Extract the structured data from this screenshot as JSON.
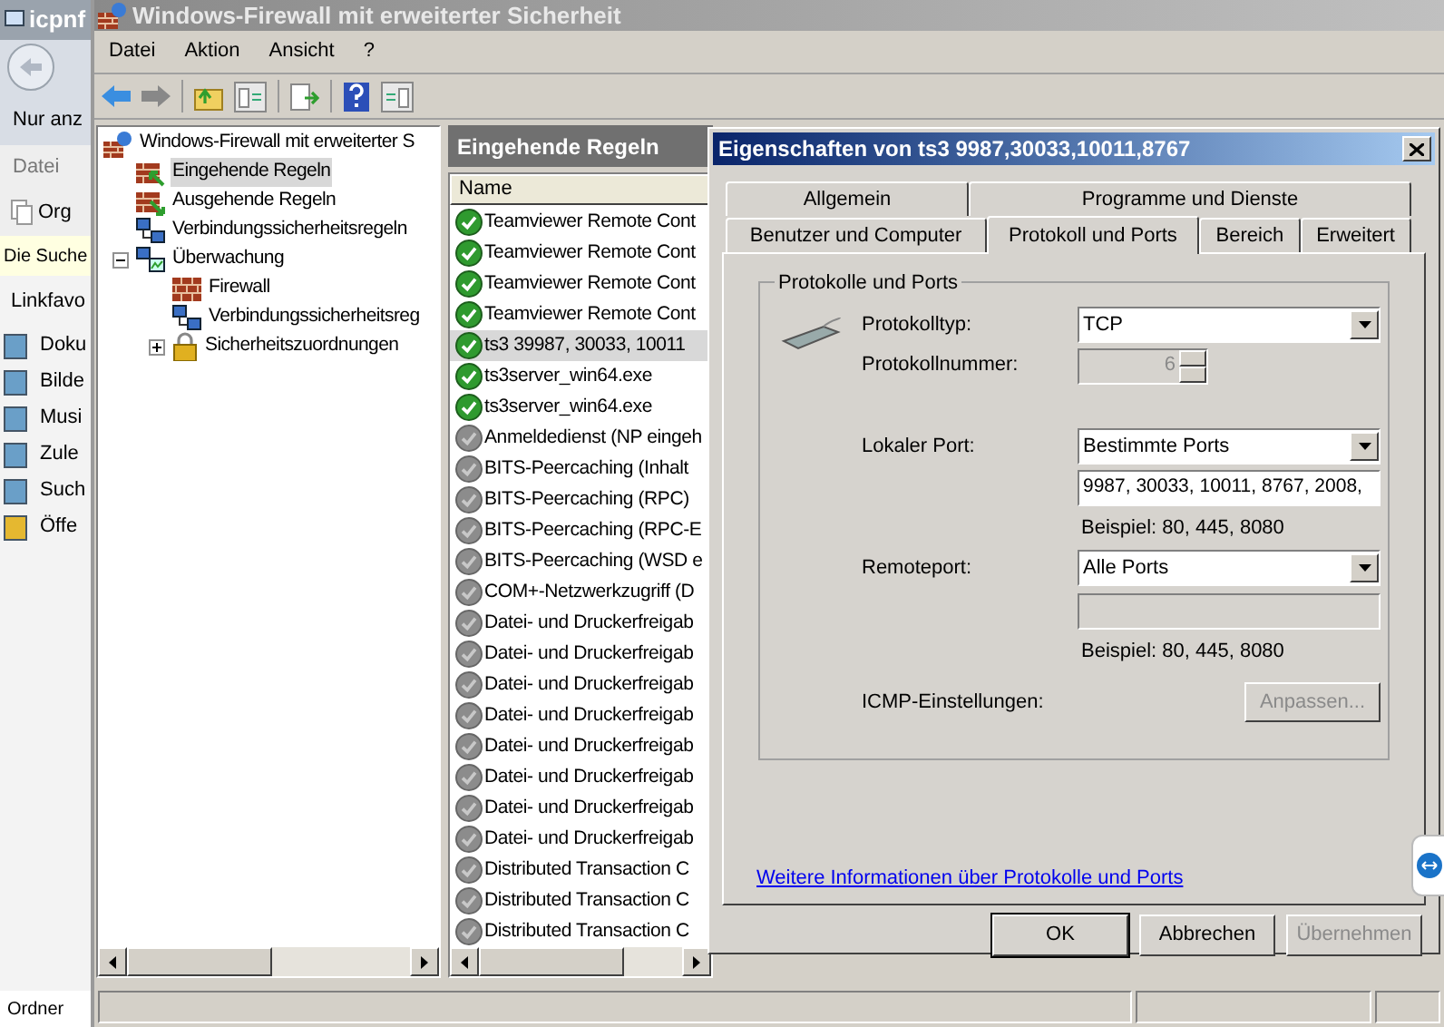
{
  "explorer": {
    "title": "icpnf",
    "address": "Nur anz",
    "menu": "Datei",
    "toolbar": "Org",
    "infobar": "Die Suche",
    "section": "Linkfavo",
    "links": [
      "Doku",
      "Bilde",
      "Musi",
      "Zule",
      "Such",
      "Öffe"
    ],
    "footer": "Ordner"
  },
  "window": {
    "title": "Windows-Firewall mit erweiterter Sicherheit"
  },
  "menu": [
    "Datei",
    "Aktion",
    "Ansicht",
    "?"
  ],
  "tree": [
    {
      "label": "Windows-Firewall mit erweiterter S",
      "kind": "root",
      "selected": false,
      "children": [
        {
          "label": "Eingehende Regeln",
          "kind": "inbound",
          "selected": true
        },
        {
          "label": "Ausgehende Regeln",
          "kind": "outbound",
          "selected": false
        },
        {
          "label": "Verbindungssicherheitsregeln",
          "kind": "network",
          "selected": false
        },
        {
          "label": "Überwachung",
          "kind": "monitor",
          "selected": false,
          "expanded": true,
          "children": [
            {
              "label": "Firewall",
              "kind": "wall",
              "selected": false
            },
            {
              "label": "Verbindungssicherheitsreg",
              "kind": "network",
              "selected": false
            },
            {
              "label": "Sicherheitszuordnungen",
              "kind": "lock",
              "selected": false,
              "expanded": false
            }
          ]
        }
      ]
    }
  ],
  "rules": {
    "title": "Eingehende Regeln",
    "column": "Name",
    "rows": [
      {
        "name": "Teamviewer Remote Cont",
        "enabled": true,
        "selected": false
      },
      {
        "name": "Teamviewer Remote Cont",
        "enabled": true,
        "selected": false
      },
      {
        "name": "Teamviewer Remote Cont",
        "enabled": true,
        "selected": false
      },
      {
        "name": "Teamviewer Remote Cont",
        "enabled": true,
        "selected": false
      },
      {
        "name": "ts3 39987, 30033, 10011",
        "enabled": true,
        "selected": true
      },
      {
        "name": "ts3server_win64.exe",
        "enabled": true,
        "selected": false
      },
      {
        "name": "ts3server_win64.exe",
        "enabled": true,
        "selected": false
      },
      {
        "name": "Anmeldedienst (NP eingeh",
        "enabled": false,
        "selected": false
      },
      {
        "name": "BITS-Peercaching (Inhalt",
        "enabled": false,
        "selected": false
      },
      {
        "name": "BITS-Peercaching (RPC)",
        "enabled": false,
        "selected": false
      },
      {
        "name": "BITS-Peercaching (RPC-E",
        "enabled": false,
        "selected": false
      },
      {
        "name": "BITS-Peercaching (WSD e",
        "enabled": false,
        "selected": false
      },
      {
        "name": "COM+-Netzwerkzugriff (D",
        "enabled": false,
        "selected": false
      },
      {
        "name": "Datei- und Druckerfreigab",
        "enabled": false,
        "selected": false
      },
      {
        "name": "Datei- und Druckerfreigab",
        "enabled": false,
        "selected": false
      },
      {
        "name": "Datei- und Druckerfreigab",
        "enabled": false,
        "selected": false
      },
      {
        "name": "Datei- und Druckerfreigab",
        "enabled": false,
        "selected": false
      },
      {
        "name": "Datei- und Druckerfreigab",
        "enabled": false,
        "selected": false
      },
      {
        "name": "Datei- und Druckerfreigab",
        "enabled": false,
        "selected": false
      },
      {
        "name": "Datei- und Druckerfreigab",
        "enabled": false,
        "selected": false
      },
      {
        "name": "Datei- und Druckerfreigab",
        "enabled": false,
        "selected": false
      },
      {
        "name": "Distributed Transaction C",
        "enabled": false,
        "selected": false
      },
      {
        "name": "Distributed Transaction C",
        "enabled": false,
        "selected": false
      },
      {
        "name": "Distributed Transaction C",
        "enabled": false,
        "selected": false
      }
    ]
  },
  "dialog": {
    "title": "Eigenschaften von ts3 9987,30033,10011,8767",
    "tabs_back": [
      {
        "label": "Allgemein",
        "selected": false
      },
      {
        "label": "Programme und Dienste",
        "selected": false
      }
    ],
    "tabs_front": [
      {
        "label": "Benutzer und Computer",
        "selected": false
      },
      {
        "label": "Protokoll und Ports",
        "selected": true
      },
      {
        "label": "Bereich",
        "selected": false
      },
      {
        "label": "Erweitert",
        "selected": false
      }
    ],
    "group": "Protokolle und Ports",
    "protocol_type": {
      "label": "Protokolltyp:",
      "value": "TCP"
    },
    "protocol_number": {
      "label": "Protokollnummer:",
      "value": "6",
      "disabled": true
    },
    "local_port": {
      "label": "Lokaler Port:",
      "value": "Bestimmte Ports",
      "ports": "9987, 30033, 10011, 8767, 2008,",
      "ports_disabled": false,
      "example": "Beispiel: 80, 445, 8080"
    },
    "remote_port": {
      "label": "Remoteport:",
      "value": "Alle Ports",
      "ports_disabled": true,
      "example": "Beispiel: 80, 445, 8080"
    },
    "icmp": {
      "label": "ICMP-Einstellungen:",
      "button": "Anpassen...",
      "disabled": true
    },
    "link": "Weitere Informationen über Protokolle und Ports",
    "buttons": [
      {
        "label": "OK",
        "default": true,
        "disabled": false
      },
      {
        "label": "Abbrechen",
        "default": false,
        "disabled": false
      },
      {
        "label": "Übernehmen",
        "default": false,
        "disabled": true
      }
    ]
  }
}
